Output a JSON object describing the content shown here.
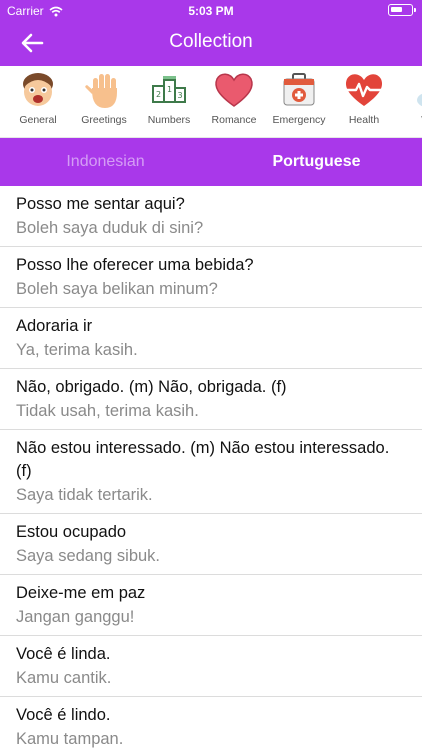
{
  "status": {
    "carrier": "Carrier",
    "time": "5:03 PM"
  },
  "header": {
    "title": "Collection"
  },
  "categories": [
    {
      "label": "General",
      "icon": "face-icon"
    },
    {
      "label": "Greetings",
      "icon": "hand-icon"
    },
    {
      "label": "Numbers",
      "icon": "podium-icon"
    },
    {
      "label": "Romance",
      "icon": "heart-icon"
    },
    {
      "label": "Emergency",
      "icon": "first-aid-kit-icon"
    },
    {
      "label": "Health",
      "icon": "heartbeat-icon"
    },
    {
      "label": "We",
      "icon": "weather-icon"
    }
  ],
  "tabs": {
    "left": "Indonesian",
    "right": "Portuguese",
    "selected": "Portuguese"
  },
  "phrases": [
    {
      "pt": "Posso me sentar aqui?",
      "id": "Boleh saya duduk di sini?"
    },
    {
      "pt": "Posso lhe oferecer uma bebida?",
      "id": "Boleh saya belikan minum?"
    },
    {
      "pt": "Adoraria ir",
      "id": "Ya, terima kasih."
    },
    {
      "pt": "Não, obrigado. (m)  Não, obrigada. (f)",
      "id": "Tidak usah, terima kasih."
    },
    {
      "pt": "Não estou interessado. (m)  Não estou interessado. (f)",
      "id": "Saya tidak tertarik."
    },
    {
      "pt": "Estou ocupado",
      "id": "Saya sedang sibuk."
    },
    {
      "pt": "Deixe-me em paz",
      "id": "Jangan ganggu!"
    },
    {
      "pt": "Você é linda.",
      "id": "Kamu cantik."
    },
    {
      "pt": "Você é lindo.",
      "id": "Kamu tampan."
    }
  ],
  "colors": {
    "accent": "#a938ea"
  }
}
